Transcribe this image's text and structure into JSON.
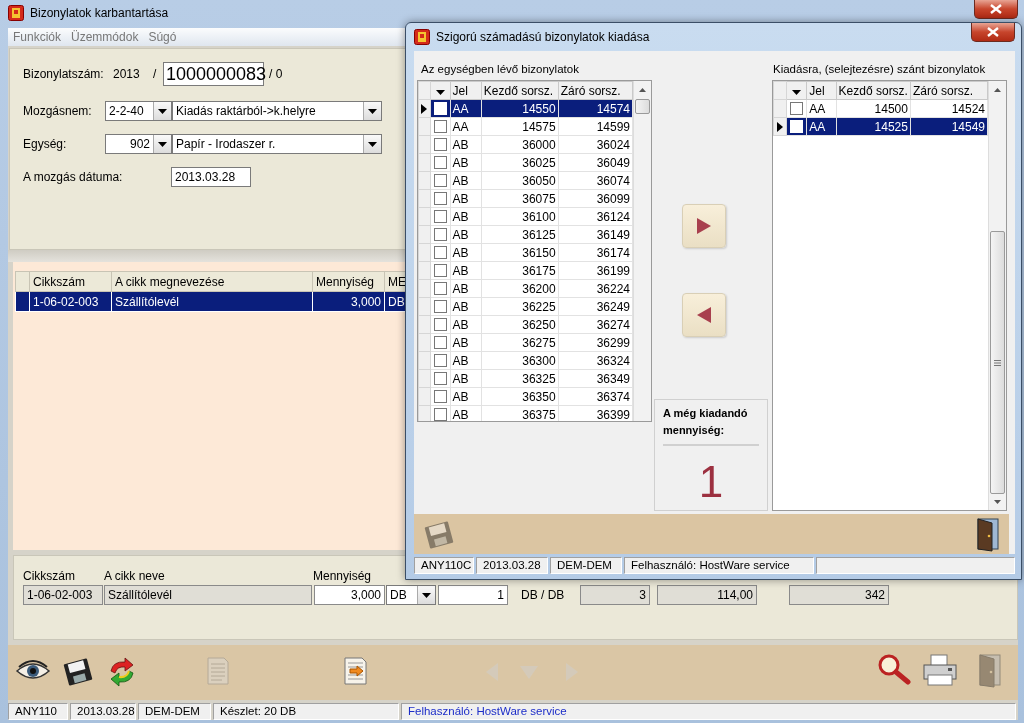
{
  "window": {
    "title": "Bizonylatok karbantartása"
  },
  "menu": [
    {
      "label": "Funkciók"
    },
    {
      "label": "Üzemmódok"
    },
    {
      "label": "Súgó"
    }
  ],
  "form": {
    "doc_label": "Bizonylatszám:",
    "doc_year": "2013",
    "doc_sep": "/",
    "doc_number": "1000000083",
    "doc_suffix": "/ 0",
    "movement": {
      "label": "Mozgásnem:",
      "code": "2-2-40",
      "name": "Kiadás raktárból->k.helyre"
    },
    "unit": {
      "label": "Egység:",
      "code": "902",
      "name": "Papír - Irodaszer r."
    },
    "date": {
      "label": "A mozgás dátuma:",
      "value": "2013.03.28"
    }
  },
  "items_table": {
    "columns": [
      "Cikkszám",
      "A cikk megnevezése",
      "Mennyiség",
      "ME"
    ],
    "rows": [
      {
        "cells": [
          "1-06-02-003",
          "Szállítólevél",
          "3,000",
          "DB"
        ],
        "selected": true
      }
    ]
  },
  "detail": {
    "headers": [
      "Cikkszám",
      "A cikk neve",
      "Mennyiség"
    ],
    "code": "1-06-02-003",
    "name": "Szállítólevél",
    "quantity": "3,000",
    "unit": "DB",
    "count": "1",
    "ratio": "DB / DB",
    "field_1": "3",
    "field_2": "114,00",
    "field_3": "342"
  },
  "toolbar": [
    {
      "kind": "eye",
      "disabled": false
    },
    {
      "kind": "floppy",
      "disabled": false
    },
    {
      "kind": "refresh",
      "disabled": false
    },
    {
      "kind": "document",
      "disabled": true
    },
    {
      "kind": "export",
      "disabled": false
    },
    {
      "kind": "left",
      "disabled": true
    },
    {
      "kind": "down",
      "disabled": true
    },
    {
      "kind": "right",
      "disabled": true
    },
    {
      "kind": "search",
      "disabled": false
    },
    {
      "kind": "printer",
      "disabled": false
    },
    {
      "kind": "door",
      "disabled": true
    }
  ],
  "status_bar": [
    "ANY110",
    "2013.03.28",
    "DEM-DEM",
    "Készlet: 20 DB",
    "Felhasználó: HostWare service"
  ],
  "dialog": {
    "title": "Szigorú számadású bizonylatok kiadása",
    "available": {
      "label": "Az egységben lévő bizonylatok",
      "columns": [
        "Jel",
        "Kezdő sorsz.",
        "Záró sorsz."
      ],
      "rows": [
        {
          "jel": "AA",
          "start": "14550",
          "end": "14574",
          "checked": false,
          "selected": true
        },
        {
          "jel": "AA",
          "start": "14575",
          "end": "14599",
          "checked": false,
          "selected": false
        },
        {
          "jel": "AB",
          "start": "36000",
          "end": "36024",
          "checked": false,
          "selected": false
        },
        {
          "jel": "AB",
          "start": "36025",
          "end": "36049",
          "checked": false,
          "selected": false
        },
        {
          "jel": "AB",
          "start": "36050",
          "end": "36074",
          "checked": false,
          "selected": false
        },
        {
          "jel": "AB",
          "start": "36075",
          "end": "36099",
          "checked": false,
          "selected": false
        },
        {
          "jel": "AB",
          "start": "36100",
          "end": "36124",
          "checked": false,
          "selected": false
        },
        {
          "jel": "AB",
          "start": "36125",
          "end": "36149",
          "checked": false,
          "selected": false
        },
        {
          "jel": "AB",
          "start": "36150",
          "end": "36174",
          "checked": false,
          "selected": false
        },
        {
          "jel": "AB",
          "start": "36175",
          "end": "36199",
          "checked": false,
          "selected": false
        },
        {
          "jel": "AB",
          "start": "36200",
          "end": "36224",
          "checked": false,
          "selected": false
        },
        {
          "jel": "AB",
          "start": "36225",
          "end": "36249",
          "checked": false,
          "selected": false
        },
        {
          "jel": "AB",
          "start": "36250",
          "end": "36274",
          "checked": false,
          "selected": false
        },
        {
          "jel": "AB",
          "start": "36275",
          "end": "36299",
          "checked": false,
          "selected": false
        },
        {
          "jel": "AB",
          "start": "36300",
          "end": "36324",
          "checked": false,
          "selected": false
        },
        {
          "jel": "AB",
          "start": "36325",
          "end": "36349",
          "checked": false,
          "selected": false
        },
        {
          "jel": "AB",
          "start": "36350",
          "end": "36374",
          "checked": false,
          "selected": false
        },
        {
          "jel": "AB",
          "start": "36375",
          "end": "36399",
          "checked": false,
          "selected": false
        }
      ]
    },
    "selected": {
      "label": "Kiadásra, (selejtezésre) szánt bizonylatok",
      "columns": [
        "Jel",
        "Kezdő sorsz.",
        "Záró sorsz."
      ],
      "rows": [
        {
          "jel": "AA",
          "start": "14500",
          "end": "14524",
          "checked": false,
          "selected": false
        },
        {
          "jel": "AA",
          "start": "14525",
          "end": "14549",
          "checked": false,
          "selected": true
        }
      ]
    },
    "remaining": {
      "label": "A még kiadandó mennyiség:",
      "value": "1"
    },
    "toolbar": [
      {
        "kind": "floppy",
        "disabled": true
      },
      {
        "kind": "door",
        "disabled": false
      }
    ],
    "status_bar": [
      "ANY110C",
      "2013.03.28",
      "DEM-DEM",
      "Felhasználó: HostWare service"
    ]
  }
}
